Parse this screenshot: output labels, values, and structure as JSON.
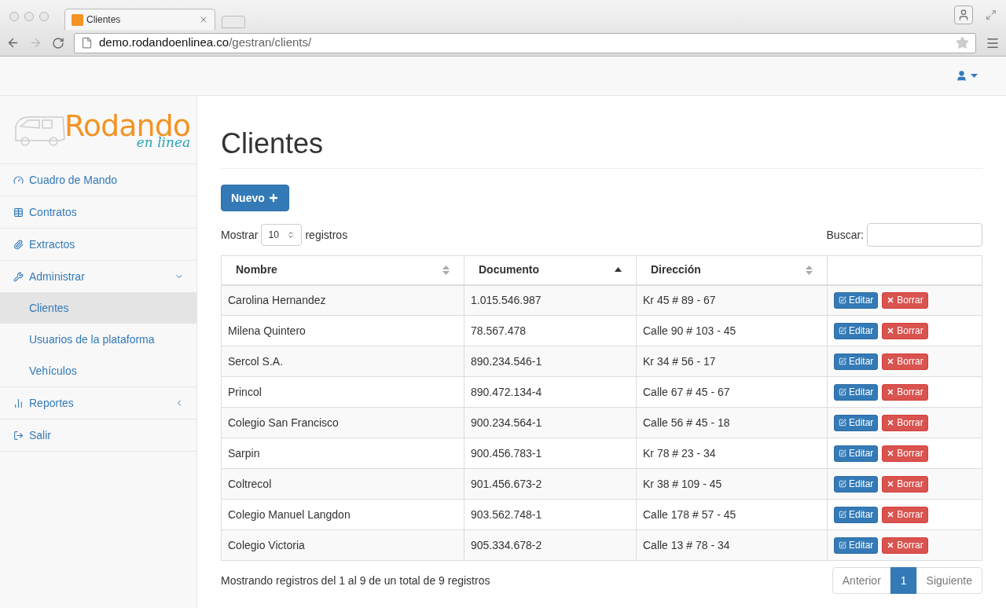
{
  "browser": {
    "tab_title": "Clientes",
    "url_host": "demo.rodandoenlinea.co",
    "url_path": "/gestran/clients/"
  },
  "logo": {
    "main": "Rodando",
    "sub": "en linea"
  },
  "sidebar": {
    "items": [
      {
        "label": "Cuadro de Mando",
        "selected": false
      },
      {
        "label": "Contratos",
        "selected": false
      },
      {
        "label": "Extractos",
        "selected": false
      },
      {
        "label": "Administrar",
        "selected": false,
        "expanded": true,
        "children": [
          {
            "label": "Clientes",
            "selected": true
          },
          {
            "label": "Usuarios de la plataforma",
            "selected": false
          },
          {
            "label": "Vehículos",
            "selected": false
          }
        ]
      },
      {
        "label": "Reportes",
        "selected": false,
        "expanded": false
      },
      {
        "label": "Salir",
        "selected": false
      }
    ]
  },
  "page": {
    "title": "Clientes",
    "new_button": "Nuevo",
    "show_label": "Mostrar",
    "page_size": "10",
    "records_label": "registros",
    "search_label": "Buscar:"
  },
  "table": {
    "columns": [
      {
        "label": "Nombre",
        "sortable": true,
        "sorted_ascending": false
      },
      {
        "label": "Documento",
        "sortable": true,
        "sorted_ascending": true
      },
      {
        "label": "Dirección",
        "sortable": true,
        "sorted_ascending": false
      },
      {
        "sortable": false
      }
    ],
    "rows": [
      {
        "cells": [
          "Carolina Hernandez",
          "1.015.546.987",
          "Kr 45 # 89 - 67"
        ],
        "edit": "Editar",
        "delete": "Borrar"
      },
      {
        "cells": [
          "Milena Quintero",
          "78.567.478",
          "Calle 90 # 103 - 45"
        ],
        "edit": "Editar",
        "delete": "Borrar"
      },
      {
        "cells": [
          "Sercol S.A.",
          "890.234.546-1",
          "Kr 34 # 56 - 17"
        ],
        "edit": "Editar",
        "delete": "Borrar"
      },
      {
        "cells": [
          "Princol",
          "890.472.134-4",
          "Calle 67 # 45 - 67"
        ],
        "edit": "Editar",
        "delete": "Borrar"
      },
      {
        "cells": [
          "Colegio San Francisco",
          "900.234.564-1",
          "Calle 56 # 45 - 18"
        ],
        "edit": "Editar",
        "delete": "Borrar"
      },
      {
        "cells": [
          "Sarpin",
          "900.456.783-1",
          "Kr 78 # 23 - 34"
        ],
        "edit": "Editar",
        "delete": "Borrar"
      },
      {
        "cells": [
          "Coltrecol",
          "901.456.673-2",
          "Kr 38 # 109 - 45"
        ],
        "edit": "Editar",
        "delete": "Borrar"
      },
      {
        "cells": [
          "Colegio Manuel Langdon",
          "903.562.748-1",
          "Calle 178 # 57 - 45"
        ],
        "edit": "Editar",
        "delete": "Borrar"
      },
      {
        "cells": [
          "Colegio Victoria",
          "905.334.678-2",
          "Calle 13 # 78 - 34"
        ],
        "edit": "Editar",
        "delete": "Borrar"
      }
    ]
  },
  "footer": {
    "info": "Mostrando registros del 1 al 9 de un total de 9 registros",
    "pagination": [
      {
        "label": "Anterior",
        "selected": false
      },
      {
        "label": "1",
        "selected": true
      },
      {
        "label": "Siguiente",
        "selected": false
      }
    ]
  }
}
